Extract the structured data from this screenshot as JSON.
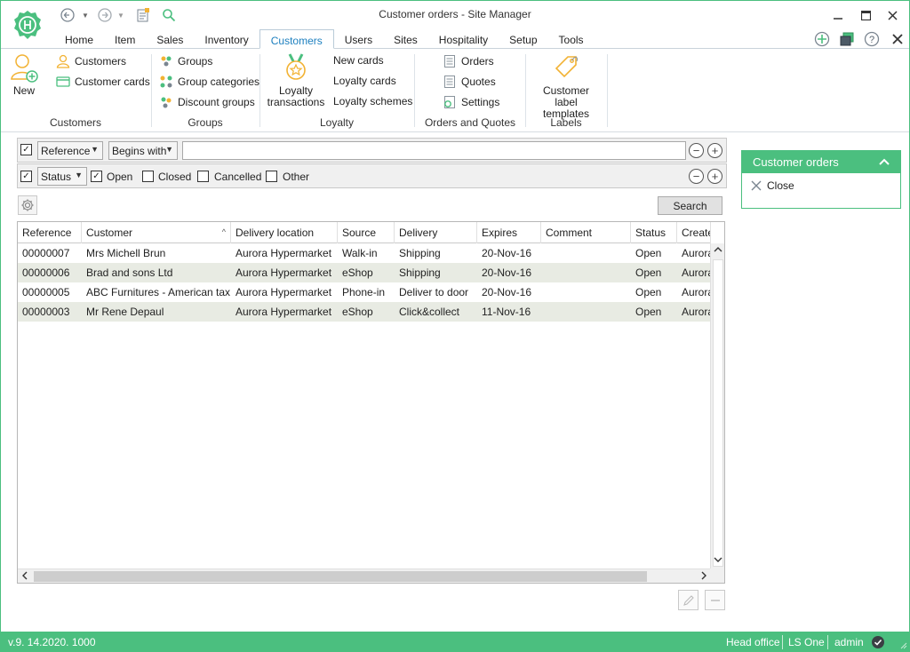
{
  "window": {
    "title": "Customer orders - Site Manager"
  },
  "tabs": [
    {
      "label": "Home"
    },
    {
      "label": "Item"
    },
    {
      "label": "Sales"
    },
    {
      "label": "Inventory"
    },
    {
      "label": "Customers"
    },
    {
      "label": "Users"
    },
    {
      "label": "Sites"
    },
    {
      "label": "Hospitality"
    },
    {
      "label": "Setup"
    },
    {
      "label": "Tools"
    }
  ],
  "active_tab": "Customers",
  "ribbon": {
    "new_label": "New",
    "customers_label": "Customers",
    "customer_cards_label": "Customer cards",
    "group_customers": "Customers",
    "groups_label": "Groups",
    "group_categories_label": "Group categories",
    "discount_groups_label": "Discount groups",
    "group_groups": "Groups",
    "loyalty_transactions_label_1": "Loyalty",
    "loyalty_transactions_label_2": "transactions",
    "new_cards_label": "New cards",
    "loyalty_cards_label": "Loyalty cards",
    "loyalty_schemes_label": "Loyalty schemes",
    "group_loyalty": "Loyalty",
    "orders_label": "Orders",
    "quotes_label": "Quotes",
    "settings_label": "Settings",
    "group_orders_quotes": "Orders and Quotes",
    "customer_label_templates_1": "Customer label",
    "customer_label_templates_2": "templates",
    "group_labels": "Labels"
  },
  "filter": {
    "field_select": "Reference",
    "operator_select": "Begins with",
    "value": "",
    "status_select": "Status",
    "open_label": "Open",
    "closed_label": "Closed",
    "cancelled_label": "Cancelled",
    "other_label": "Other",
    "open_checked": true,
    "closed_checked": false,
    "cancelled_checked": false,
    "other_checked": false
  },
  "search_label": "Search",
  "grid": {
    "columns": [
      "Reference",
      "Customer",
      "Delivery location",
      "Source",
      "Delivery",
      "Expires",
      "Comment",
      "Status",
      "Create"
    ],
    "rows": [
      [
        "00000007",
        "Mrs Michell Brun",
        "Aurora Hypermarket",
        "Walk-in",
        "Shipping",
        "20-Nov-16",
        "",
        "Open",
        "Aurora"
      ],
      [
        "00000006",
        "Brad and sons Ltd",
        "Aurora Hypermarket",
        "eShop",
        "Shipping",
        "20-Nov-16",
        "",
        "Open",
        "Aurora"
      ],
      [
        "00000005",
        "ABC Furnitures - American tax",
        "Aurora Hypermarket",
        "Phone-in",
        "Deliver to door",
        "20-Nov-16",
        "",
        "Open",
        "Aurora"
      ],
      [
        "00000003",
        "Mr Rene Depaul",
        "Aurora Hypermarket",
        "eShop",
        "Click&collect",
        "11-Nov-16",
        "",
        "Open",
        "Aurora"
      ]
    ]
  },
  "side_panel": {
    "title": "Customer orders",
    "close_label": "Close"
  },
  "statusbar": {
    "version": "v.9. 14.2020. 1000",
    "site": "Head office",
    "product": "LS One",
    "user": "admin"
  },
  "colors": {
    "accent": "#4bbf7f",
    "active_tab": "#1c7fbf",
    "alt_row": "#e8ebe3"
  }
}
